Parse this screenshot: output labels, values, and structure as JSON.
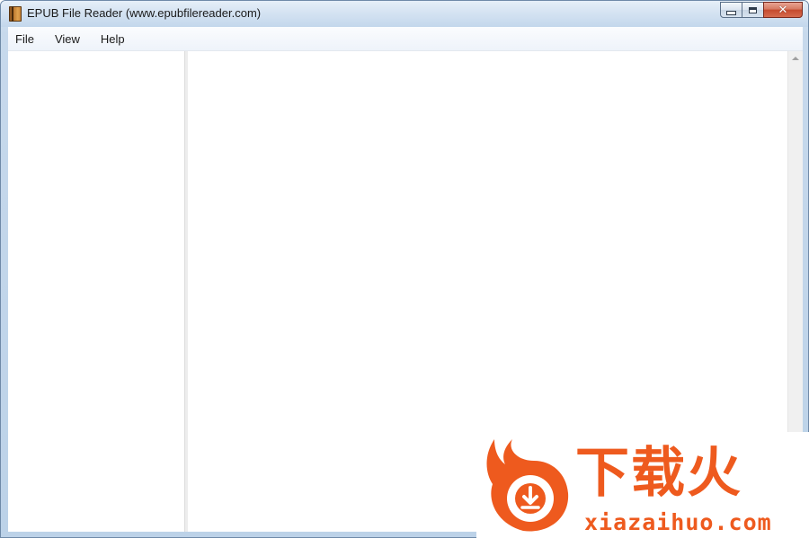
{
  "window": {
    "title": "EPUB File Reader (www.epubfilereader.com)",
    "icon": "book-icon",
    "caption_buttons": [
      {
        "name": "minimize",
        "icon": "minimize-icon"
      },
      {
        "name": "maximize",
        "icon": "maximize-icon"
      },
      {
        "name": "close",
        "icon": "close-icon",
        "glyph": "✕"
      }
    ]
  },
  "menubar": {
    "items": [
      {
        "label": "File"
      },
      {
        "label": "View"
      },
      {
        "label": "Help"
      }
    ]
  },
  "watermark": {
    "chinese_text": "下载火",
    "url": "xiazaihuo.com",
    "color": "#ee5a1e"
  },
  "colors": {
    "titlebar": "#c7d9ec",
    "close_button": "#c44a2e",
    "client_background": "#ffffff",
    "splitter": "#ededed"
  }
}
